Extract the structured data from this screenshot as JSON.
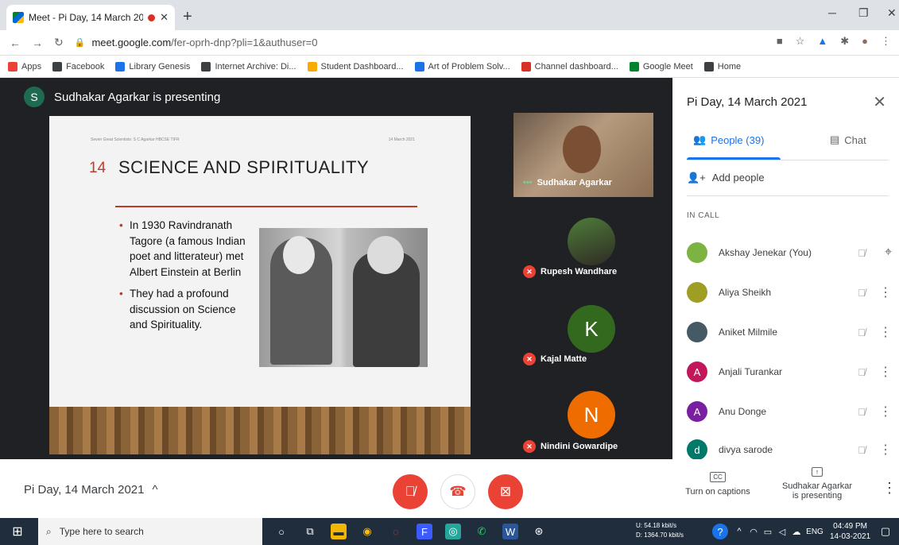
{
  "browser": {
    "tab_title": "Meet - Pi Day, 14 March 202",
    "url_host": "meet.google.com",
    "url_path": "/fer-oprh-dnp?pli=1&authuser=0",
    "bookmarks": [
      {
        "label": "Apps",
        "color": "#ea4335"
      },
      {
        "label": "Facebook",
        "color": "#3c4043"
      },
      {
        "label": "Library Genesis",
        "color": "#1a73e8"
      },
      {
        "label": "Internet Archive: Di...",
        "color": "#3c4043"
      },
      {
        "label": "Student Dashboard...",
        "color": "#f9ab00"
      },
      {
        "label": "Art of Problem Solv...",
        "color": "#1a73e8"
      },
      {
        "label": "Channel dashboard...",
        "color": "#d93025"
      },
      {
        "label": "Google Meet",
        "color": "#00832d"
      },
      {
        "label": "Home",
        "color": "#3c4043"
      }
    ]
  },
  "stage": {
    "presenter_initial": "S",
    "presenter_text": "Sudhakar Agarkar is presenting"
  },
  "slide": {
    "header_left": "Seven Great Scientists: S C Agarkar HBCSE TIFR",
    "header_right": "14 March 2021",
    "number": "14",
    "title": "SCIENCE AND SPIRITUALITY",
    "bullets": [
      "In 1930 Ravindranath Tagore (a famous Indian poet and litterateur) met Albert Einstein at Berlin",
      "They had a profound discussion on Science and Spirituality."
    ]
  },
  "tiles": [
    {
      "name": "Sudhakar Agarkar",
      "initial": ""
    },
    {
      "name": "Rupesh Wandhare",
      "initial": ""
    },
    {
      "name": "Kajal Matte",
      "initial": "K",
      "color": "#33691e"
    },
    {
      "name": "Nindini Gowardipe",
      "initial": "N",
      "color": "#ef6c00"
    }
  ],
  "panel": {
    "title": "Pi Day, 14 March 2021",
    "people_tab": "People (39)",
    "chat_tab": "Chat",
    "add_people": "Add people",
    "in_call": "IN CALL",
    "people": [
      {
        "name": "Akshay Jenekar (You)",
        "initial": "",
        "color": "#7cb342"
      },
      {
        "name": "Aliya Sheikh",
        "initial": "",
        "color": "#9e9d24"
      },
      {
        "name": "Aniket Milmile",
        "initial": "",
        "color": "#455a64"
      },
      {
        "name": "Anjali Turankar",
        "initial": "A",
        "color": "#c2185b"
      },
      {
        "name": "Anu Donge",
        "initial": "A",
        "color": "#7b1fa2"
      },
      {
        "name": "divya sarode",
        "initial": "d",
        "color": "#00796b"
      }
    ]
  },
  "bottom": {
    "meeting_title": "Pi Day, 14 March 2021",
    "captions": "Turn on captions",
    "presenting_line1": "Sudhakar Agarkar",
    "presenting_line2": "is presenting"
  },
  "taskbar": {
    "search_placeholder": "Type here to search",
    "net_up": "U:     54.18 kbit/s",
    "net_down": "D:  1364.70 kbit/s",
    "lang": "ENG",
    "time": "04:49 PM",
    "date": "14-03-2021"
  }
}
